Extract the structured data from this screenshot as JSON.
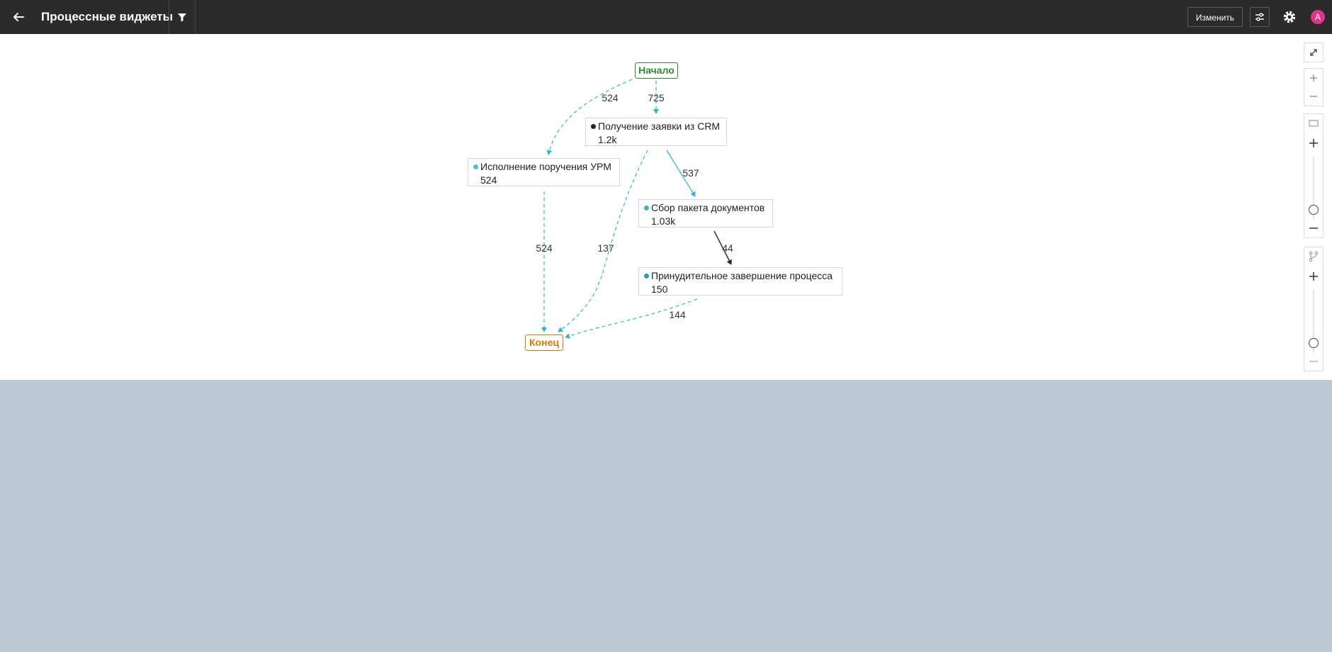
{
  "header": {
    "title": "Процессные виджеты",
    "edit_label": "Изменить",
    "avatar_letter": "A",
    "avatar_color": "#e0338c"
  },
  "graph": {
    "start_label": "Начало",
    "end_label": "Конец",
    "start_color": "#2e8b2e",
    "end_color": "#d97700",
    "edge_color": "#2bb8c8",
    "nodes": [
      {
        "name": "Получение заявки из CRM",
        "count": "1.2k",
        "dot_color": "#0f2a3a"
      },
      {
        "name": "Исполнение поручения УРМ",
        "count": "524",
        "dot_color": "#4cc4c4"
      },
      {
        "name": "Сбор пакета документов",
        "count": "1.03k",
        "dot_color": "#3db5b5"
      },
      {
        "name": "Принудительное завершение процесса",
        "count": "150",
        "dot_color": "#2f9ea8"
      }
    ],
    "edges": [
      {
        "label": "524"
      },
      {
        "label": "725"
      },
      {
        "label": "537"
      },
      {
        "label": "524"
      },
      {
        "label": "137"
      },
      {
        "label": "44"
      },
      {
        "label": "144"
      }
    ]
  },
  "toolbar_icons": [
    "fit-screen-icon",
    "zoom-in-icon",
    "zoom-out-icon",
    "node-detail-icon",
    "path-detail-icon"
  ]
}
